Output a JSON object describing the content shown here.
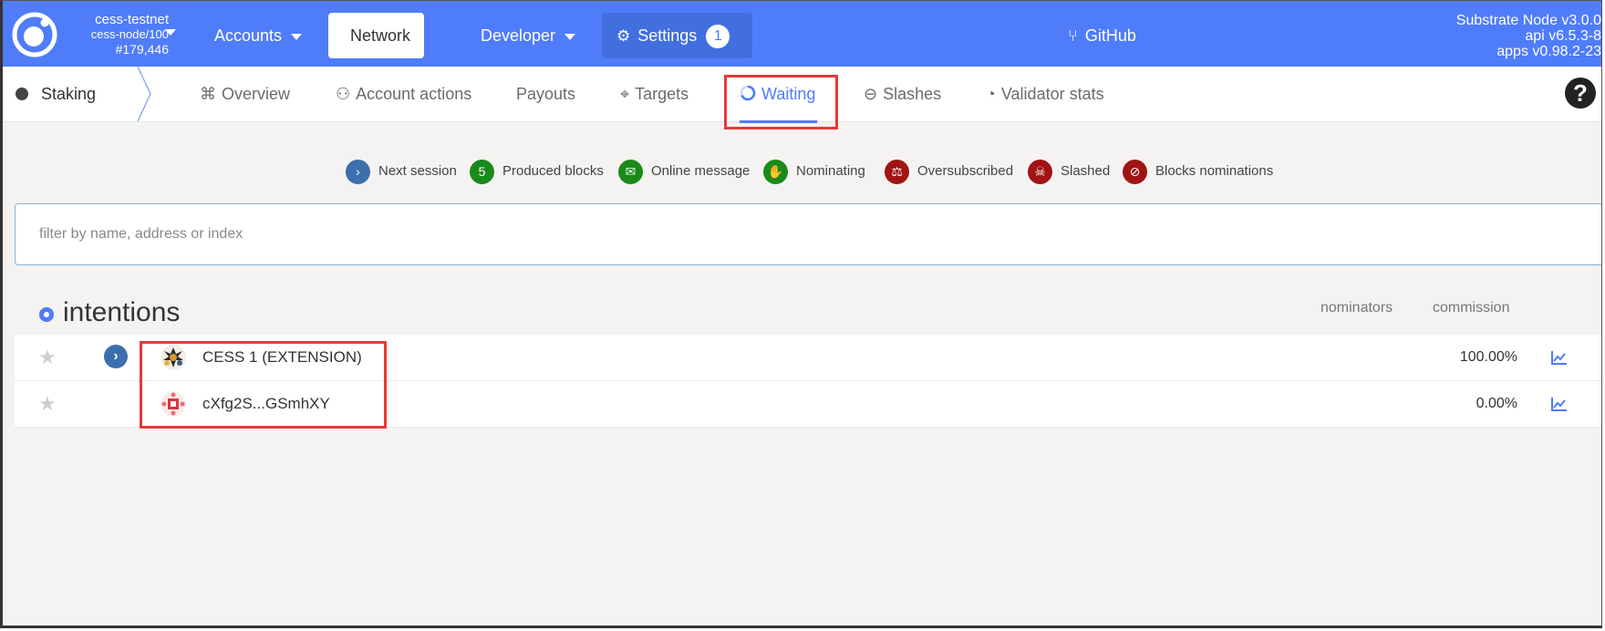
{
  "header": {
    "chain_name": "cess-testnet",
    "node_name": "cess-node/100",
    "block_number": "#179,446",
    "nav": {
      "accounts": "Accounts",
      "network": "Network",
      "developer": "Developer",
      "settings": "Settings",
      "settings_badge": "1",
      "github": "GitHub"
    },
    "node_info": {
      "line1": "Substrate Node v3.0.0",
      "line2": "api v6.5.3-8",
      "line3": "apps v0.98.2-23"
    }
  },
  "subnav": {
    "section": "Staking",
    "tabs": [
      "Overview",
      "Account actions",
      "Payouts",
      "Targets",
      "Waiting",
      "Slashes",
      "Validator stats"
    ],
    "selected_tab": "Waiting",
    "help": "?"
  },
  "legend": {
    "next_session": "Next session",
    "produced_blocks_count": "5",
    "produced_blocks": "Produced blocks",
    "online_message": "Online message",
    "nominating": "Nominating",
    "oversubscribed": "Oversubscribed",
    "slashed": "Slashed",
    "blocks_nominations": "Blocks nominations"
  },
  "filter": {
    "placeholder": "filter by name, address or index",
    "value": ""
  },
  "intentions": {
    "title": "intentions",
    "columns": {
      "nominators": "nominators",
      "commission": "commission"
    },
    "rows": [
      {
        "name": "CESS 1 (EXTENSION)",
        "commission": "100.00%",
        "expandable": true
      },
      {
        "name": "cXfg2S...GSmhXY",
        "commission": "0.00%",
        "expandable": false
      }
    ]
  },
  "colors": {
    "accent": "#4f7cf8",
    "highlight_box": "#e53939",
    "legend_blue": "#3c6fad",
    "legend_green": "#1a8a1a",
    "legend_red": "#a01414"
  }
}
